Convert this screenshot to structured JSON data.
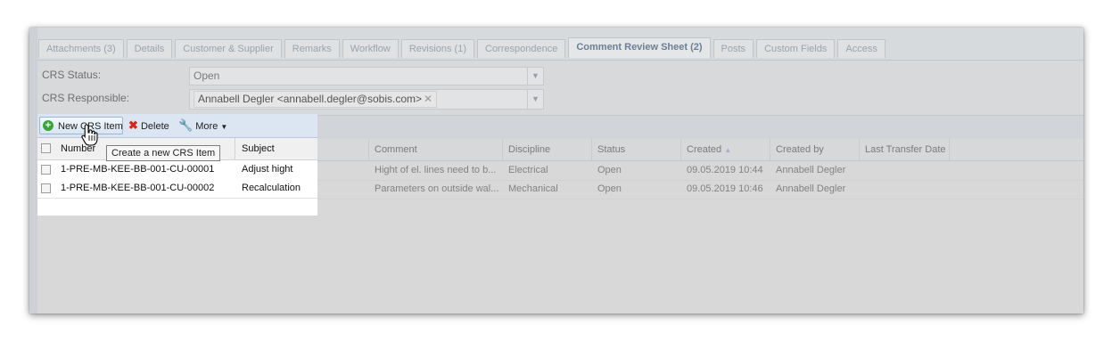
{
  "tabs": [
    {
      "label": "Attachments (3)",
      "active": false
    },
    {
      "label": "Details",
      "active": false
    },
    {
      "label": "Customer & Supplier",
      "active": false
    },
    {
      "label": "Remarks",
      "active": false
    },
    {
      "label": "Workflow",
      "active": false
    },
    {
      "label": "Revisions (1)",
      "active": false
    },
    {
      "label": "Correspondence",
      "active": false
    },
    {
      "label": "Comment Review Sheet (2)",
      "active": true
    },
    {
      "label": "Posts",
      "active": false
    },
    {
      "label": "Custom Fields",
      "active": false
    },
    {
      "label": "Access",
      "active": false
    }
  ],
  "form": {
    "status_label": "CRS Status:",
    "status_value": "Open",
    "responsible_label": "CRS Responsible:",
    "responsible_value": "Annabell Degler <annabell.degler@sobis.com>",
    "remove_glyph": "✕",
    "dropdown_glyph": "▼"
  },
  "toolbar": {
    "new_label": "New CRS Item",
    "delete_label": "Delete",
    "more_label": "More",
    "tooltip": "Create a new CRS Item"
  },
  "grid": {
    "columns": [
      "Number",
      "Subject",
      "Comment",
      "Discipline",
      "Status",
      "Created",
      "Created by",
      "Last Transfer Date"
    ],
    "sort_indicator": "▲",
    "rows": [
      {
        "number": "1-PRE-MB-KEE-BB-001-CU-00001",
        "subject": "Adjust hight",
        "comment": "Hight of el. lines need to b...",
        "discipline": "Electrical",
        "status": "Open",
        "created": "09.05.2019 10:44",
        "created_by": "Annabell Degler",
        "last_transfer": ""
      },
      {
        "number": "1-PRE-MB-KEE-BB-001-CU-00002",
        "subject": "Recalculation",
        "comment": "Parameters on outside wal...",
        "discipline": "Mechanical",
        "status": "Open",
        "created": "09.05.2019 10:46",
        "created_by": "Annabell Degler",
        "last_transfer": ""
      }
    ]
  },
  "colors": {
    "accent": "#6b7f95",
    "add_green": "#3aa53a",
    "delete_red": "#d9261c"
  }
}
